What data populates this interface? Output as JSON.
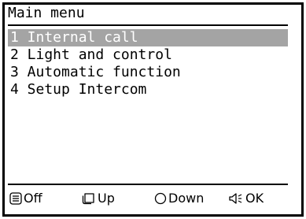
{
  "menu": {
    "title": "Main menu",
    "items": [
      {
        "label": "1 Internal call",
        "selected": true
      },
      {
        "label": "2 Light and control",
        "selected": false
      },
      {
        "label": "3 Automatic function",
        "selected": false
      },
      {
        "label": "4 Setup Intercom",
        "selected": false
      }
    ]
  },
  "softkeys": {
    "off": {
      "label": "Off",
      "icon": "menu-list-icon"
    },
    "up": {
      "label": "Up",
      "icon": "square-key-icon"
    },
    "down": {
      "label": "Down",
      "icon": "round-key-icon"
    },
    "ok": {
      "label": "OK",
      "icon": "speaker-key-icon"
    }
  },
  "colors": {
    "selection_bg": "#a4a4a4",
    "selection_text": "#ffffff",
    "foreground": "#000000",
    "background": "#ffffff"
  }
}
